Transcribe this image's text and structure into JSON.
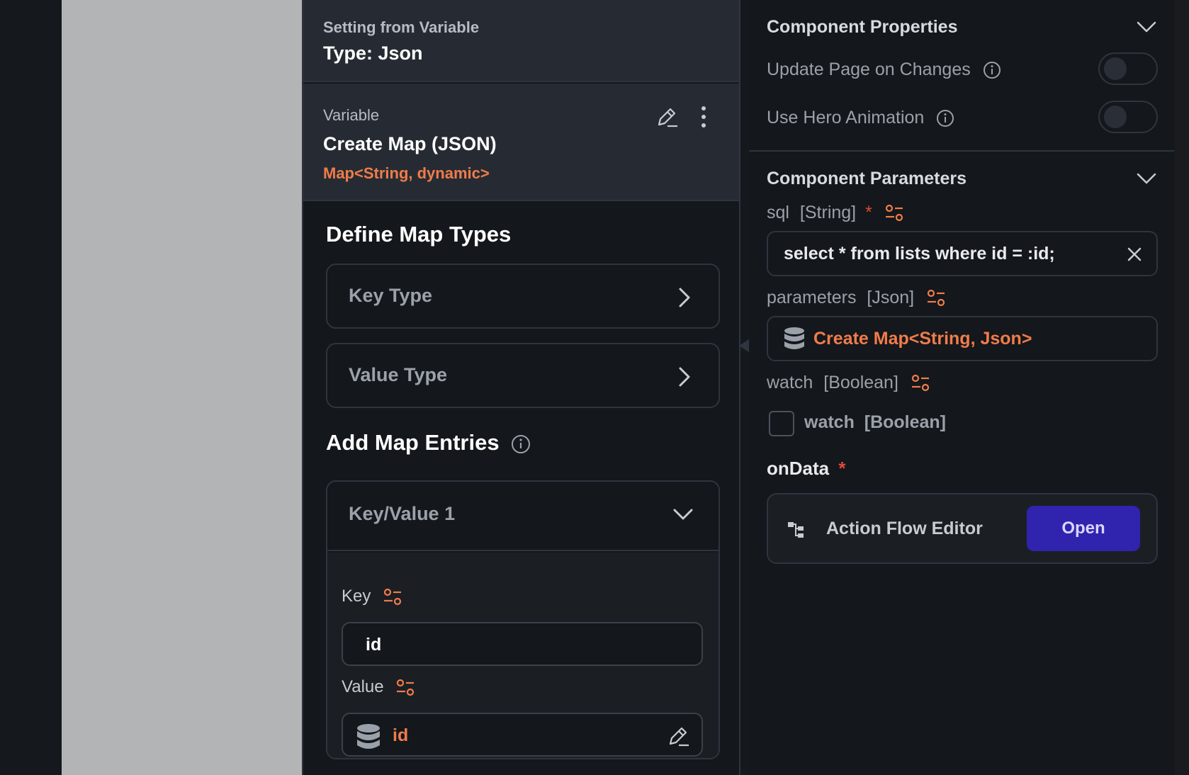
{
  "popup": {
    "header_sub": "Setting from Variable",
    "header_main": "Type: Json",
    "variable": {
      "label": "Variable",
      "name": "Create Map (JSON)",
      "type": "Map<String, dynamic>"
    },
    "define_title": "Define Map Types",
    "key_type_label": "Key Type",
    "value_type_label": "Value Type",
    "add_entries_title": "Add Map Entries",
    "entry": {
      "title": "Key/Value 1",
      "key_label": "Key",
      "key_value": "id",
      "value_label": "Value",
      "value_value": "id"
    }
  },
  "right_panel": {
    "component_properties_title": "Component Properties",
    "update_page_label": "Update Page on Changes",
    "hero_animation_label": "Use Hero Animation",
    "component_parameters_title": "Component Parameters",
    "sql_label": "sql",
    "sql_type": "[String]",
    "sql_required": "*",
    "sql_value": "select * from lists where id = :id;",
    "parameters_label": "parameters",
    "parameters_type": "[Json]",
    "parameters_value": "Create Map<String, Json>",
    "watch_label": "watch",
    "watch_type": "[Boolean]",
    "watch_checkbox_label": "watch  [Boolean]",
    "ondata_label": "onData",
    "ondata_required": "*",
    "action_flow_label": "Action Flow Editor",
    "open_label": "Open"
  },
  "colors": {
    "accent_orange": "#f07c4a",
    "open_button": "#3023ae",
    "required_red": "#e0483a"
  }
}
